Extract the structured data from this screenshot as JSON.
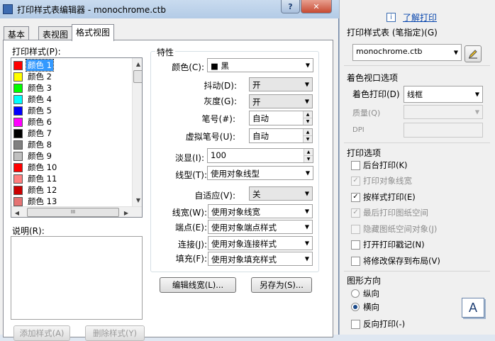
{
  "dialog": {
    "title": "打印样式表编辑器 - monochrome.ctb",
    "help_btn": "?",
    "close_btn": "✕",
    "tabs": [
      {
        "label": "基本",
        "active": false
      },
      {
        "label": "表视图",
        "active": false
      },
      {
        "label": "格式视图",
        "active": true
      }
    ],
    "styles_label": "打印样式(P):",
    "styles": [
      {
        "label": "颜色 1",
        "color": "#ff0000"
      },
      {
        "label": "颜色 2",
        "color": "#ffff00"
      },
      {
        "label": "颜色 3",
        "color": "#00ff00"
      },
      {
        "label": "颜色 4",
        "color": "#00ffff"
      },
      {
        "label": "颜色 5",
        "color": "#0000ff"
      },
      {
        "label": "颜色 6",
        "color": "#ff00ff"
      },
      {
        "label": "颜色 7",
        "color": "#000000"
      },
      {
        "label": "颜色 8",
        "color": "#808080"
      },
      {
        "label": "颜色 9",
        "color": "#c0c0c0"
      },
      {
        "label": "颜色 10",
        "color": "#ff0000"
      },
      {
        "label": "颜色 11",
        "color": "#ff7f7f"
      },
      {
        "label": "颜色 12",
        "color": "#cc0000"
      },
      {
        "label": "颜色 13",
        "color": "#e57373"
      }
    ],
    "selected_style_index": 0,
    "hscroll_grip": "III",
    "description_label": "说明(R):",
    "add_style_button": "添加样式(A)",
    "delete_style_button": "删除样式(Y)",
    "properties": {
      "group_label": "特性",
      "color_label": "颜色(C):",
      "color_value": "■ 黑",
      "dither_label": "抖动(D):",
      "dither_value": "开",
      "grayscale_label": "灰度(G):",
      "grayscale_value": "开",
      "pen_label": "笔号(#):",
      "pen_value": "自动",
      "virtual_pen_label": "虚拟笔号(U):",
      "virtual_pen_value": "自动",
      "screening_label": "淡显(I):",
      "screening_value": "100",
      "linetype_label": "线型(T):",
      "linetype_value": "使用对象线型",
      "adaptive_label": "自适应(V):",
      "adaptive_value": "关",
      "lineweight_label": "线宽(W):",
      "lineweight_value": "使用对象线宽",
      "endstyle_label": "端点(E):",
      "endstyle_value": "使用对象端点样式",
      "joinstyle_label": "连接(J):",
      "joinstyle_value": "使用对象连接样式",
      "fillstyle_label": "填充(F):",
      "fillstyle_value": "使用对象填充样式"
    },
    "edit_lineweights_button": "编辑线宽(L)...",
    "save_as_button": "另存为(S)..."
  },
  "right_panel": {
    "learn_link": "了解打印",
    "plot_style_table_label": "打印样式表 (笔指定)(G)",
    "plot_style_table_value": "monochrome.ctb",
    "shaded_viewport_label": "着色视口选项",
    "shade_plot_label": "着色打印(D)",
    "shade_plot_value": "线框",
    "quality_label": "质量(Q)",
    "dpi_label": "DPI",
    "plot_options_label": "打印选项",
    "plot_options": [
      {
        "label": "后台打印(K)",
        "checked": false,
        "disabled": false
      },
      {
        "label": "打印对象线宽",
        "checked": true,
        "disabled": true
      },
      {
        "label": "按样式打印(E)",
        "checked": true,
        "disabled": false
      },
      {
        "label": "最后打印图纸空间",
        "checked": true,
        "disabled": true
      },
      {
        "label": "隐藏图纸空间对象(J)",
        "checked": false,
        "disabled": true
      },
      {
        "label": "打开打印戳记(N)",
        "checked": false,
        "disabled": false
      },
      {
        "label": "将修改保存到布局(V)",
        "checked": false,
        "disabled": false
      }
    ],
    "orientation_label": "图形方向",
    "portrait_label": "纵向",
    "landscape_label": "横向",
    "orientation_selected": "横向",
    "upside_down_label": "反向打印(-)",
    "orientation_preview_letter": "A"
  }
}
